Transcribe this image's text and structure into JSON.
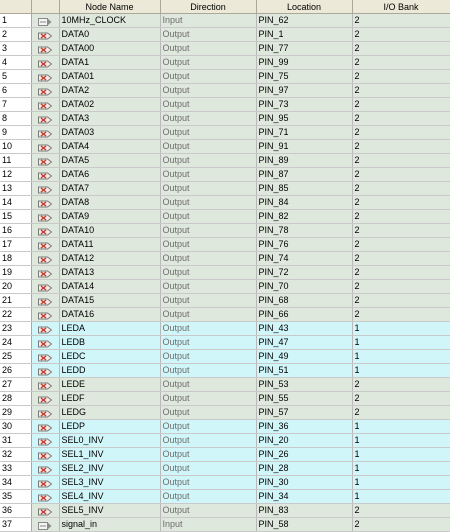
{
  "columns": [
    "",
    "",
    "Node Name",
    "Direction",
    "Location",
    "I/O Bank"
  ],
  "colors": {
    "green_row": "#dfe8dc",
    "cyan_row": "#d0f6fa",
    "input_icon": "#8a8a8a",
    "output_icon": "#c0392b"
  },
  "rows": [
    {
      "num": "1",
      "icon": "input-pin-icon",
      "name": "10MHz_CLOCK",
      "dir": "Input",
      "loc": "PIN_62",
      "bank": "2",
      "tone": "g"
    },
    {
      "num": "2",
      "icon": "output-pin-icon",
      "name": "DATA0",
      "dir": "Output",
      "loc": "PIN_1",
      "bank": "2",
      "tone": "g"
    },
    {
      "num": "3",
      "icon": "output-pin-icon",
      "name": "DATA00",
      "dir": "Output",
      "loc": "PIN_77",
      "bank": "2",
      "tone": "g"
    },
    {
      "num": "4",
      "icon": "output-pin-icon",
      "name": "DATA1",
      "dir": "Output",
      "loc": "PIN_99",
      "bank": "2",
      "tone": "g"
    },
    {
      "num": "5",
      "icon": "output-pin-icon",
      "name": "DATA01",
      "dir": "Output",
      "loc": "PIN_75",
      "bank": "2",
      "tone": "g"
    },
    {
      "num": "6",
      "icon": "output-pin-icon",
      "name": "DATA2",
      "dir": "Output",
      "loc": "PIN_97",
      "bank": "2",
      "tone": "g"
    },
    {
      "num": "7",
      "icon": "output-pin-icon",
      "name": "DATA02",
      "dir": "Output",
      "loc": "PIN_73",
      "bank": "2",
      "tone": "g"
    },
    {
      "num": "8",
      "icon": "output-pin-icon",
      "name": "DATA3",
      "dir": "Output",
      "loc": "PIN_95",
      "bank": "2",
      "tone": "g"
    },
    {
      "num": "9",
      "icon": "output-pin-icon",
      "name": "DATA03",
      "dir": "Output",
      "loc": "PIN_71",
      "bank": "2",
      "tone": "g"
    },
    {
      "num": "10",
      "icon": "output-pin-icon",
      "name": "DATA4",
      "dir": "Output",
      "loc": "PIN_91",
      "bank": "2",
      "tone": "g"
    },
    {
      "num": "11",
      "icon": "output-pin-icon",
      "name": "DATA5",
      "dir": "Output",
      "loc": "PIN_89",
      "bank": "2",
      "tone": "g"
    },
    {
      "num": "12",
      "icon": "output-pin-icon",
      "name": "DATA6",
      "dir": "Output",
      "loc": "PIN_87",
      "bank": "2",
      "tone": "g"
    },
    {
      "num": "13",
      "icon": "output-pin-icon",
      "name": "DATA7",
      "dir": "Output",
      "loc": "PIN_85",
      "bank": "2",
      "tone": "g"
    },
    {
      "num": "14",
      "icon": "output-pin-icon",
      "name": "DATA8",
      "dir": "Output",
      "loc": "PIN_84",
      "bank": "2",
      "tone": "g"
    },
    {
      "num": "15",
      "icon": "output-pin-icon",
      "name": "DATA9",
      "dir": "Output",
      "loc": "PIN_82",
      "bank": "2",
      "tone": "g"
    },
    {
      "num": "16",
      "icon": "output-pin-icon",
      "name": "DATA10",
      "dir": "Output",
      "loc": "PIN_78",
      "bank": "2",
      "tone": "g"
    },
    {
      "num": "17",
      "icon": "output-pin-icon",
      "name": "DATA11",
      "dir": "Output",
      "loc": "PIN_76",
      "bank": "2",
      "tone": "g"
    },
    {
      "num": "18",
      "icon": "output-pin-icon",
      "name": "DATA12",
      "dir": "Output",
      "loc": "PIN_74",
      "bank": "2",
      "tone": "g"
    },
    {
      "num": "19",
      "icon": "output-pin-icon",
      "name": "DATA13",
      "dir": "Output",
      "loc": "PIN_72",
      "bank": "2",
      "tone": "g"
    },
    {
      "num": "20",
      "icon": "output-pin-icon",
      "name": "DATA14",
      "dir": "Output",
      "loc": "PIN_70",
      "bank": "2",
      "tone": "g"
    },
    {
      "num": "21",
      "icon": "output-pin-icon",
      "name": "DATA15",
      "dir": "Output",
      "loc": "PIN_68",
      "bank": "2",
      "tone": "g"
    },
    {
      "num": "22",
      "icon": "output-pin-icon",
      "name": "DATA16",
      "dir": "Output",
      "loc": "PIN_66",
      "bank": "2",
      "tone": "g"
    },
    {
      "num": "23",
      "icon": "output-pin-icon",
      "name": "LEDA",
      "dir": "Output",
      "loc": "PIN_43",
      "bank": "1",
      "tone": "b"
    },
    {
      "num": "24",
      "icon": "output-pin-icon",
      "name": "LEDB",
      "dir": "Output",
      "loc": "PIN_47",
      "bank": "1",
      "tone": "b"
    },
    {
      "num": "25",
      "icon": "output-pin-icon",
      "name": "LEDC",
      "dir": "Output",
      "loc": "PIN_49",
      "bank": "1",
      "tone": "b"
    },
    {
      "num": "26",
      "icon": "output-pin-icon",
      "name": "LEDD",
      "dir": "Output",
      "loc": "PIN_51",
      "bank": "1",
      "tone": "b"
    },
    {
      "num": "27",
      "icon": "output-pin-icon",
      "name": "LEDE",
      "dir": "Output",
      "loc": "PIN_53",
      "bank": "2",
      "tone": "g"
    },
    {
      "num": "28",
      "icon": "output-pin-icon",
      "name": "LEDF",
      "dir": "Output",
      "loc": "PIN_55",
      "bank": "2",
      "tone": "g"
    },
    {
      "num": "29",
      "icon": "output-pin-icon",
      "name": "LEDG",
      "dir": "Output",
      "loc": "PIN_57",
      "bank": "2",
      "tone": "g"
    },
    {
      "num": "30",
      "icon": "output-pin-icon",
      "name": "LEDP",
      "dir": "Output",
      "loc": "PIN_36",
      "bank": "1",
      "tone": "b"
    },
    {
      "num": "31",
      "icon": "output-pin-icon",
      "name": "SEL0_INV",
      "dir": "Output",
      "loc": "PIN_20",
      "bank": "1",
      "tone": "b"
    },
    {
      "num": "32",
      "icon": "output-pin-icon",
      "name": "SEL1_INV",
      "dir": "Output",
      "loc": "PIN_26",
      "bank": "1",
      "tone": "b"
    },
    {
      "num": "33",
      "icon": "output-pin-icon",
      "name": "SEL2_INV",
      "dir": "Output",
      "loc": "PIN_28",
      "bank": "1",
      "tone": "b"
    },
    {
      "num": "34",
      "icon": "output-pin-icon",
      "name": "SEL3_INV",
      "dir": "Output",
      "loc": "PIN_30",
      "bank": "1",
      "tone": "b"
    },
    {
      "num": "35",
      "icon": "output-pin-icon",
      "name": "SEL4_INV",
      "dir": "Output",
      "loc": "PIN_34",
      "bank": "1",
      "tone": "b"
    },
    {
      "num": "36",
      "icon": "output-pin-icon",
      "name": "SEL5_INV",
      "dir": "Output",
      "loc": "PIN_83",
      "bank": "2",
      "tone": "g"
    },
    {
      "num": "37",
      "icon": "input-pin-icon",
      "name": "signal_in",
      "dir": "Input",
      "loc": "PIN_58",
      "bank": "2",
      "tone": "g"
    }
  ]
}
